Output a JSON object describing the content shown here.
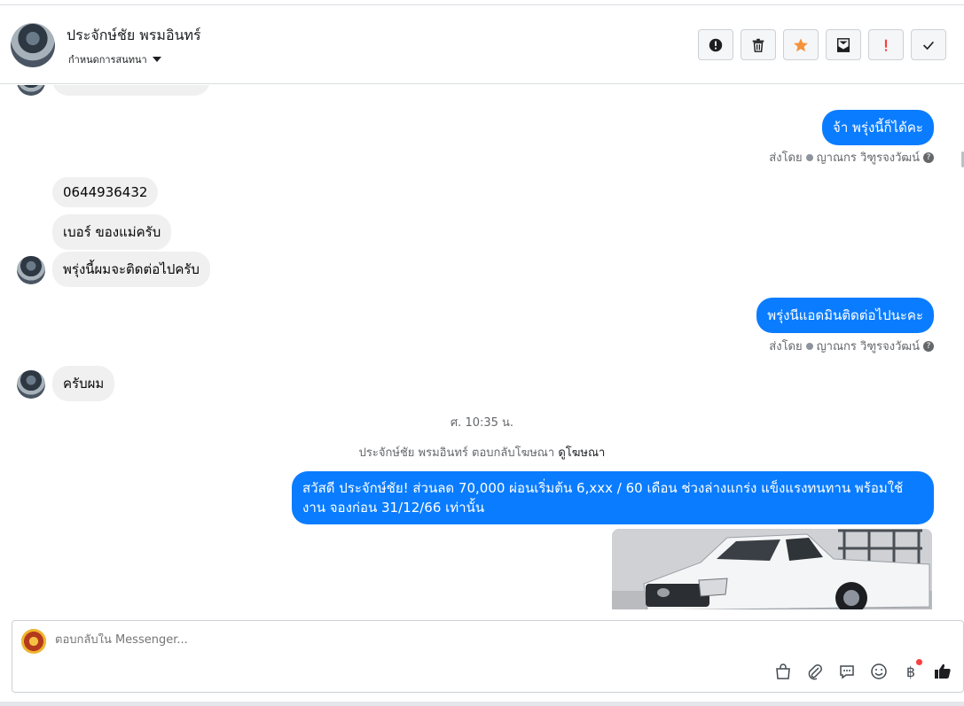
{
  "header": {
    "contact_name": "ประจักษ์ชัย พรมอินทร์",
    "assign_label": "กำหนดการสนทนา"
  },
  "toolbar": {
    "buttons": [
      {
        "icon": "alert-icon"
      },
      {
        "icon": "trash-icon"
      },
      {
        "icon": "star-icon",
        "color": "#f7923a"
      },
      {
        "icon": "mark-unread-icon"
      },
      {
        "icon": "important-icon",
        "color": "#fa3e3e"
      },
      {
        "icon": "check-icon"
      }
    ]
  },
  "messages": {
    "out1": "จ้า พรุ่งนี้ก็ได้คะ",
    "sent_by_prefix": "ส่งโดย",
    "sent_by_name": "ญาณกร วิฑูรจงวัฒน์",
    "in1": "0644936432",
    "in2": "เบอร์  ของแม่ครับ",
    "in3": "พรุ่งนี้ผมจะติดต่อไปครับ",
    "out2": "พรุ่งนีแอดมินติดต่อไปนะคะ",
    "in4": "ครับผม",
    "timestamp": "ศ. 10:35 น.",
    "ad_reply_text": "ประจักษ์ชัย พรมอินทร์ ตอบกลับโฆษณา",
    "ad_reply_link": "ดูโฆษณา",
    "out3": "สวัสดี ประจักษ์ชัย! ส่วนลด 70,000 ผ่อนเริ่มต้น 6,xxx / 60 เดือน ช่วงล่างแกร่ง แข็งแรงทนทาน พร้อมใช้งาน จองก่อน 31/12/66 เท่านั้น"
  },
  "composer": {
    "placeholder": "ตอบกลับใน Messenger...",
    "baht_symbol": "฿",
    "like_color": "#1c1e21"
  },
  "colors": {
    "bubble_out": "#0a7cff",
    "bubble_in": "#f0f0f0"
  }
}
